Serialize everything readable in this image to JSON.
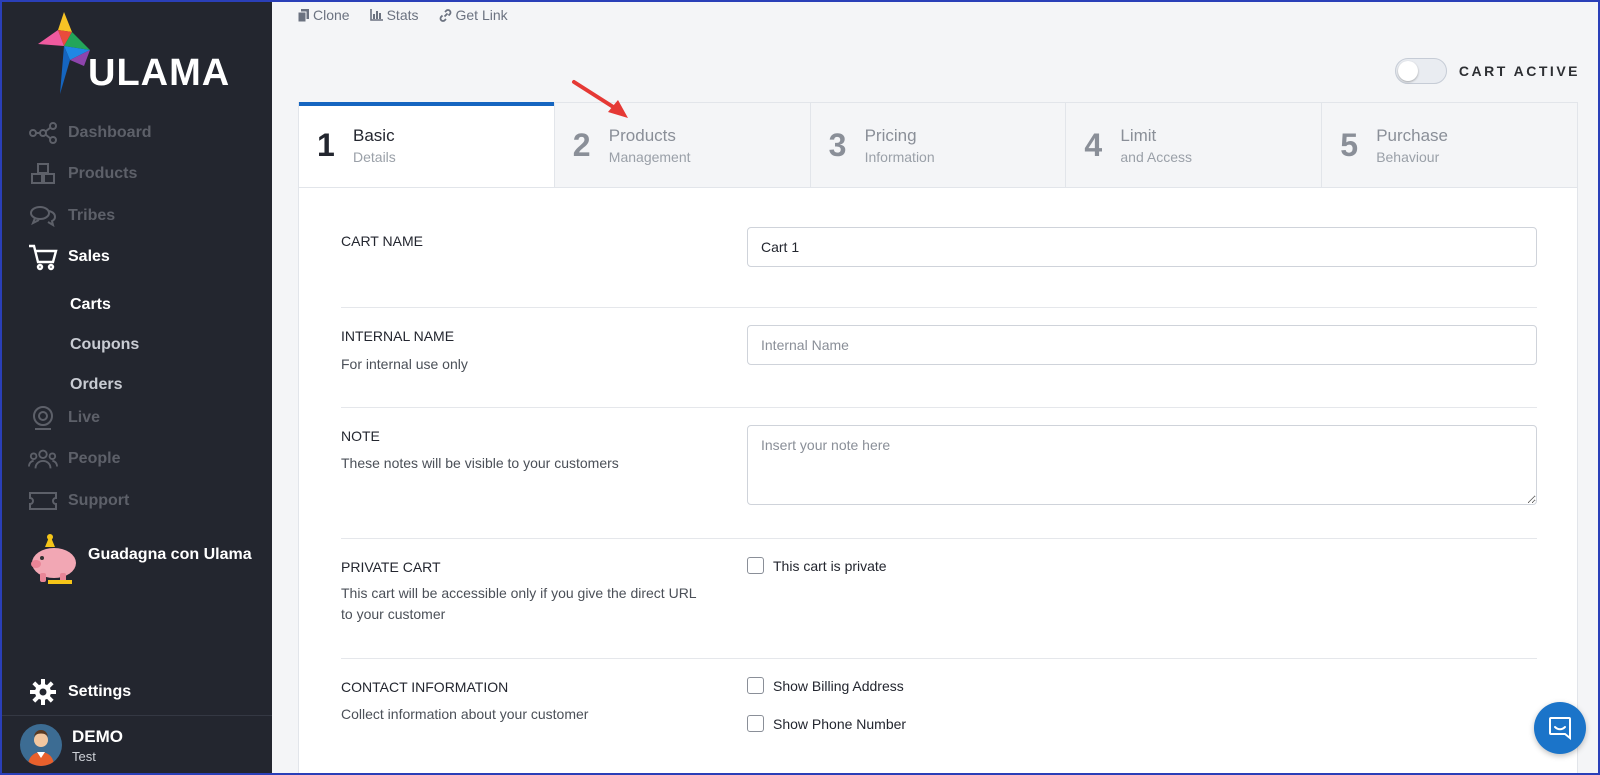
{
  "brand": {
    "name": "ULAMA"
  },
  "sidebar": {
    "items": [
      {
        "label": "Dashboard",
        "icon": "dashboard-icon"
      },
      {
        "label": "Products",
        "icon": "cubes-icon"
      },
      {
        "label": "Tribes",
        "icon": "chat-bubbles-icon"
      },
      {
        "label": "Sales",
        "icon": "cart-icon"
      },
      {
        "label": "Live",
        "icon": "webcam-icon"
      },
      {
        "label": "People",
        "icon": "people-icon"
      },
      {
        "label": "Support",
        "icon": "ticket-icon"
      }
    ],
    "sub_items": [
      {
        "label": "Carts"
      },
      {
        "label": "Coupons"
      },
      {
        "label": "Orders"
      }
    ],
    "promo_label": "Guadagna con Ulama",
    "settings_label": "Settings",
    "user": {
      "name": "DEMO",
      "role": "Test"
    }
  },
  "toolbar": {
    "clone_label": "Clone",
    "stats_label": "Stats",
    "get_link_label": "Get Link"
  },
  "cart_active": {
    "label": "CART ACTIVE",
    "on": false
  },
  "steps": [
    {
      "num": "1",
      "title": "Basic",
      "subtitle": "Details"
    },
    {
      "num": "2",
      "title": "Products",
      "subtitle": "Management"
    },
    {
      "num": "3",
      "title": "Pricing",
      "subtitle": "Information"
    },
    {
      "num": "4",
      "title": "Limit",
      "subtitle": "and Access"
    },
    {
      "num": "5",
      "title": "Purchase",
      "subtitle": "Behaviour"
    }
  ],
  "form": {
    "cart_name": {
      "label": "CART NAME",
      "value": "Cart 1"
    },
    "internal_name": {
      "label": "INTERNAL NAME",
      "desc": "For internal use only",
      "placeholder": "Internal Name"
    },
    "note": {
      "label": "NOTE",
      "desc": "These notes will be visible to your customers",
      "placeholder": "Insert your note here"
    },
    "private_cart": {
      "label": "PRIVATE CART",
      "desc": "This cart will be accessible only if you give the direct URL to your customer",
      "checkbox": "This cart is private"
    },
    "contact": {
      "label": "CONTACT INFORMATION",
      "desc": "Collect information about your customer",
      "billing": "Show Billing Address",
      "phone": "Show Phone Number"
    }
  },
  "colors": {
    "sidebar_bg": "#23262f",
    "accent": "#1565c0",
    "annotation_arrow": "#e53935"
  }
}
